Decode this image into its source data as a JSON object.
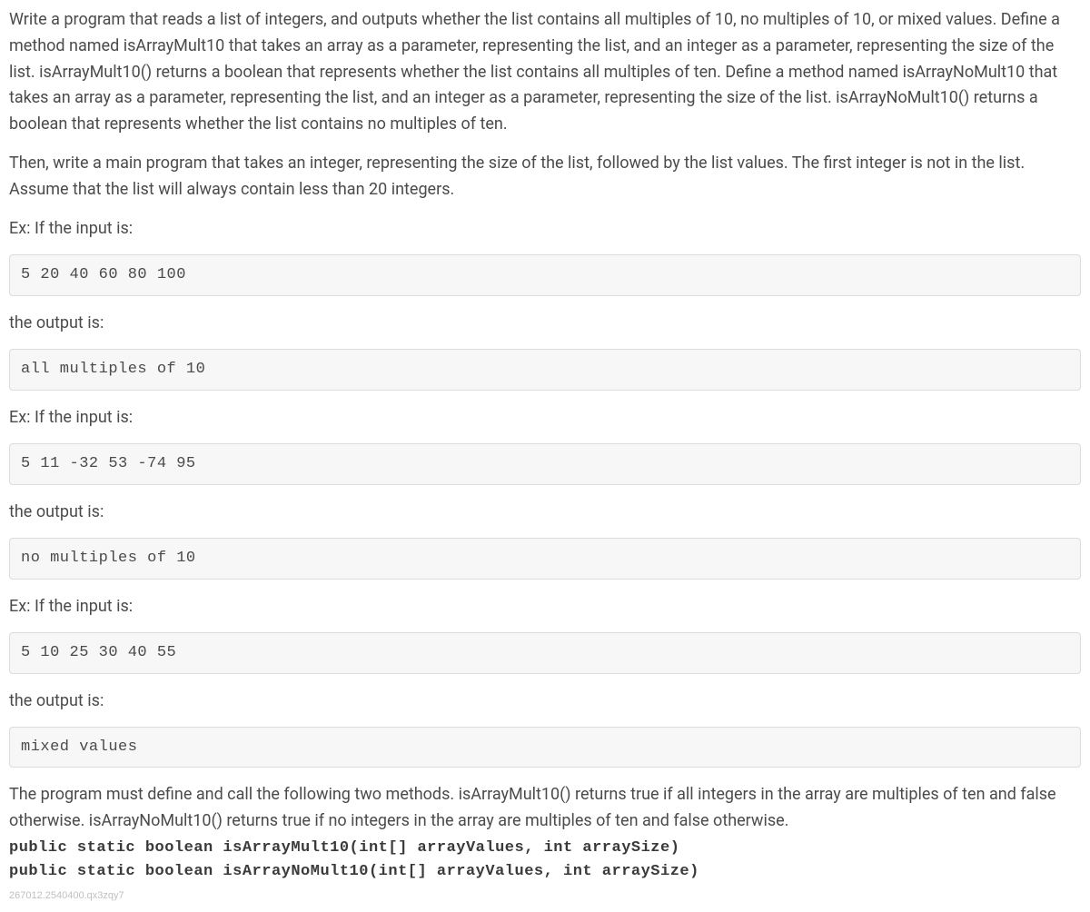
{
  "paragraphs": {
    "intro": "Write a program that reads a list of integers, and outputs whether the list contains all multiples of 10, no multiples of 10, or mixed values. Define a method named isArrayMult10 that takes an array as a parameter, representing the list, and an integer as a parameter, representing the size of the list. isArrayMult10() returns a boolean that represents whether the list contains all multiples of ten. Define a method named isArrayNoMult10 that takes an array as a parameter, representing the list, and an integer as a parameter, representing the size of the list. isArrayNoMult10() returns a boolean that represents whether the list contains no multiples of ten.",
    "main_program": "Then, write a main program that takes an integer, representing the size of the list, followed by the list values. The first integer is not in the list. Assume that the list will always contain less than 20 integers.",
    "ex_input_label": "Ex: If the input is:",
    "output_label": "the output is:",
    "conclusion": "The program must define and call the following two methods. isArrayMult10() returns true if all integers in the array are multiples of ten and false otherwise. isArrayNoMult10() returns true if no integers in the array are multiples of ten and false otherwise."
  },
  "code_blocks": {
    "input1": "5 20 40 60 80 100",
    "output1": "all multiples of 10",
    "input2": "5 11 -32 53 -74 95",
    "output2": "no multiples of 10",
    "input3": "5 10 25 30 40 55",
    "output3": "mixed values"
  },
  "method_signatures": {
    "sig1": "public static boolean isArrayMult10(int[] arrayValues, int arraySize)",
    "sig2": "public static boolean isArrayNoMult10(int[] arrayValues, int arraySize)"
  },
  "footer": "267012.2540400.qx3zqy7"
}
